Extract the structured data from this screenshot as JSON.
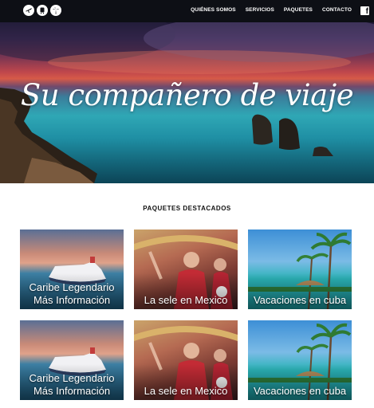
{
  "nav": {
    "logo_icons": [
      "plane-icon",
      "bus-icon",
      "palm-tree-icon"
    ],
    "links": [
      "QUIÉNES SOMOS",
      "SERVICIOS",
      "PAQUETES",
      "CONTACTO"
    ],
    "social_icon": "facebook-icon"
  },
  "hero": {
    "title": "Su compañero de viaje"
  },
  "packages": {
    "title": "PAQUETES DESTACADOS",
    "rows": [
      [
        {
          "line1": "Caribe Legendario",
          "line2": "Más Información",
          "image": "cruise-ship"
        },
        {
          "line1": "La sele en Mexico",
          "line2": "",
          "image": "football-fans"
        },
        {
          "line1": "Vacaciones en cuba",
          "line2": "",
          "image": "tropical-beach"
        }
      ],
      [
        {
          "line1": "Caribe Legendario",
          "line2": "Más Información",
          "image": "cruise-ship"
        },
        {
          "line1": "La sele en Mexico",
          "line2": "",
          "image": "football-fans"
        },
        {
          "line1": "Vacaciones en cuba",
          "line2": "",
          "image": "tropical-beach"
        }
      ]
    ]
  },
  "colors": {
    "nav_bg": "#0d0f15",
    "text_dark": "#111111"
  }
}
